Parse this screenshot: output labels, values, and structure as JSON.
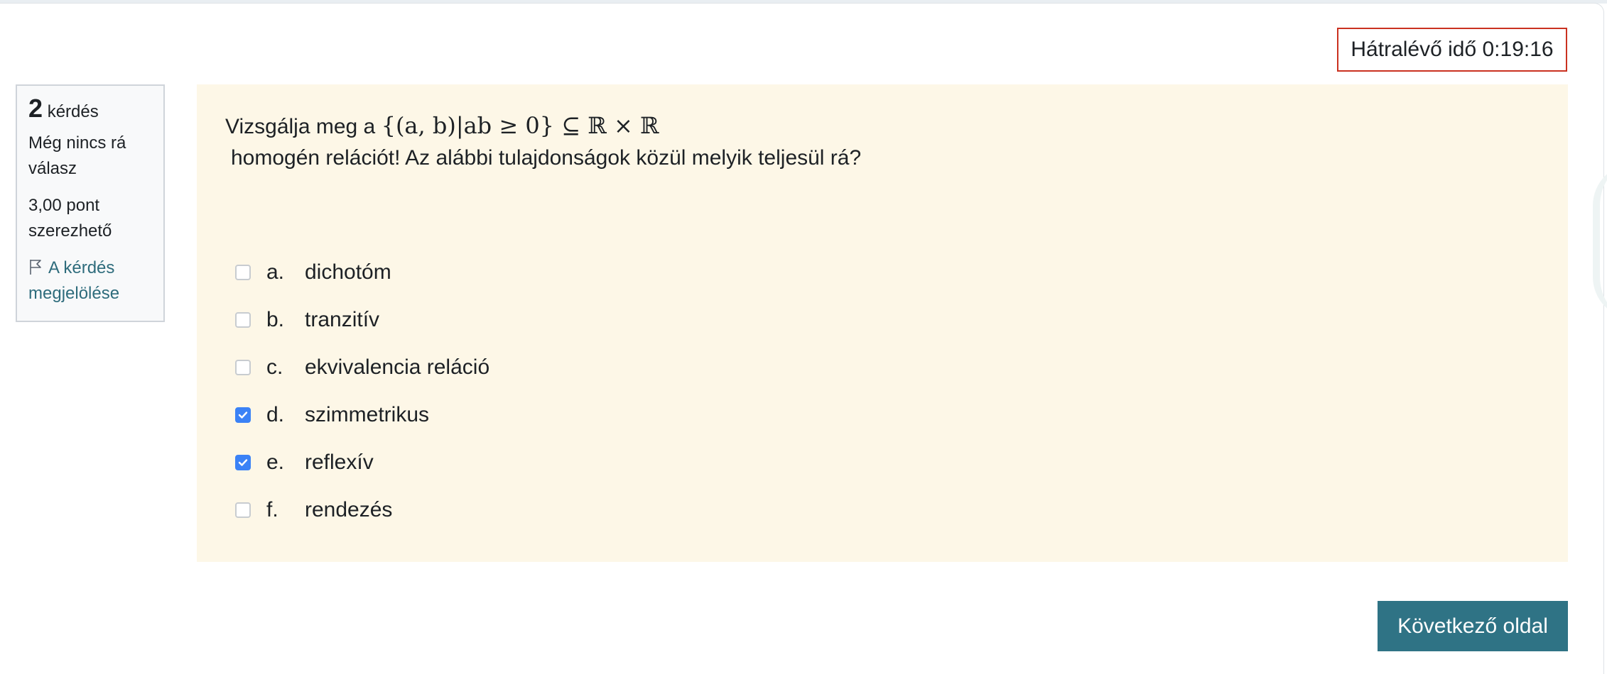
{
  "timer": {
    "text": "Hátralévő idő 0:19:16"
  },
  "info": {
    "question_number": "2",
    "question_word": "kérdés",
    "state": "Még nincs rá válasz",
    "grade": "3,00 pont szerezhető",
    "flag_label": "A kérdés megjelölése"
  },
  "question": {
    "prefix": "Vizsgálja meg a",
    "formula": "{(a, b)|ab ≥ 0} ⊆ ℝ × ℝ",
    "line2": "homogén relációt! Az alábbi tulajdonságok közül melyik teljesül rá?"
  },
  "answers": [
    {
      "letter": "a.",
      "text": "dichotóm",
      "checked": false
    },
    {
      "letter": "b.",
      "text": "tranzitív",
      "checked": false
    },
    {
      "letter": "c.",
      "text": "ekvivalencia reláció",
      "checked": false
    },
    {
      "letter": "d.",
      "text": "szimmetrikus",
      "checked": true
    },
    {
      "letter": "e.",
      "text": "reflexív",
      "checked": true
    },
    {
      "letter": "f.",
      "text": "rendezés",
      "checked": false
    }
  ],
  "navigation": {
    "next_label": "Következő oldal"
  },
  "colors": {
    "accent": "#2f7385",
    "checkbox_checked": "#3b82f6",
    "timer_border": "#ca3120",
    "question_bg": "#fdf7e7"
  }
}
